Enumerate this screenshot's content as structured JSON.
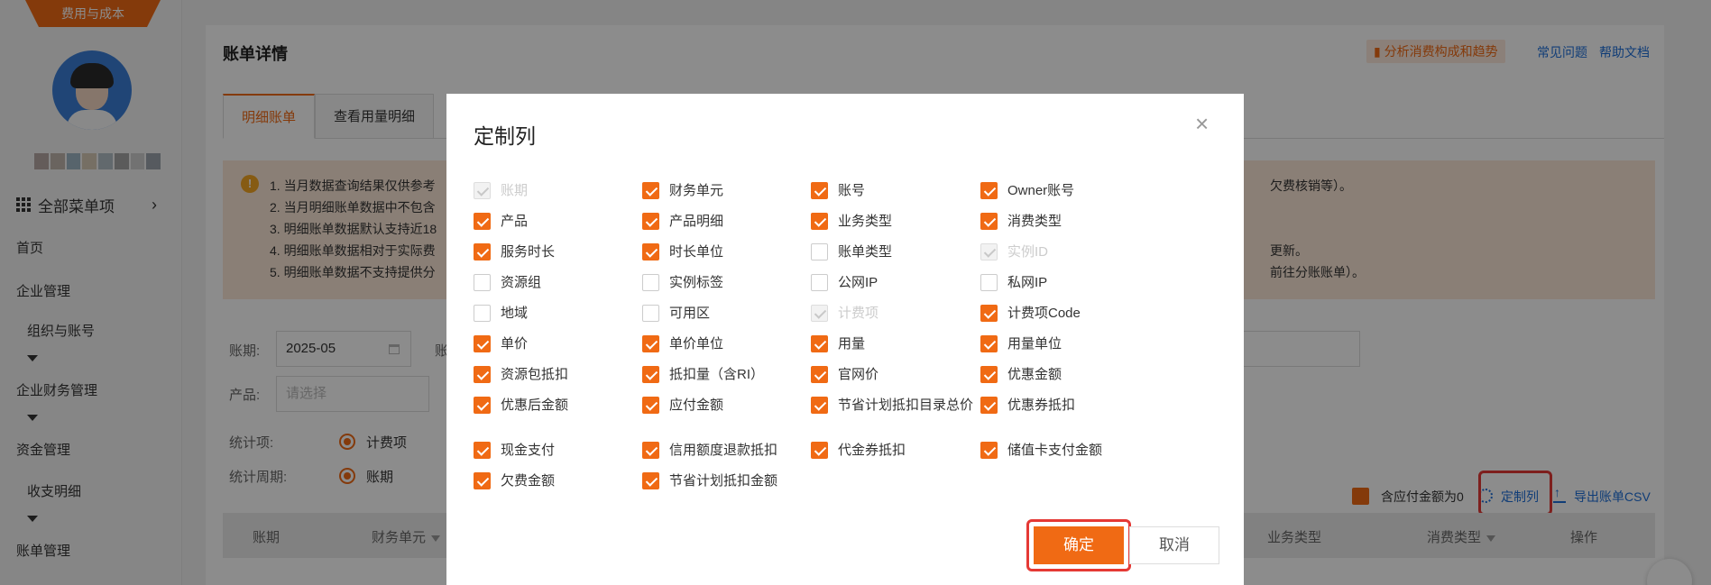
{
  "sidebar": {
    "brand_tab": "费用与成本",
    "name_blur_colors": [
      "#b7a8a5",
      "#c2b6ad",
      "#9fb7c5",
      "#d7cbb7",
      "#b3bfc6",
      "#a7a7a7",
      "#cfcfcf",
      "#9da5ad"
    ],
    "all_menu": "全部菜单项",
    "items": [
      "首页",
      "企业管理",
      "组织与账号",
      "企业财务管理",
      "资金管理",
      "收支明细",
      "账单管理"
    ]
  },
  "main": {
    "title": "账单详情",
    "analysis_button": "分析消费构成和趋势",
    "faq_link": "常见问题",
    "help_link": "帮助文档",
    "tabs": [
      "明细账单",
      "查看用量明细"
    ],
    "notice_lines": [
      "1. 当月数据查询结果仅供参考",
      "2. 当月明细账单数据中不包含",
      "3. 明细账单数据默认支持近18",
      "4. 明细账单数据相对于实际费",
      "5. 明细账单数据不支持提供分"
    ],
    "notice_tails": [
      "欠费核销等）。",
      "更新。",
      "前往分账账单）。"
    ],
    "filters": {
      "period_label": "账期:",
      "period_value": "2025-05",
      "account_label_partial": "账",
      "product_label": "产品:",
      "product_placeholder": "请选择",
      "stat_item_label": "统计项:",
      "stat_item_value": "计费项",
      "stat_period_label": "统计周期:",
      "stat_period_value": "账期"
    },
    "toolbar": {
      "zero_amount_label": "含应付金额为0",
      "customize_columns": "定制列",
      "export_csv": "导出账单CSV"
    },
    "table_headers": [
      "账期",
      "财务单元",
      "业务类型",
      "消费类型",
      "操作"
    ]
  },
  "modal": {
    "title": "定制列",
    "close": "×",
    "confirm": "确定",
    "cancel": "取消",
    "columns": [
      {
        "label": "账期",
        "state": "disabled"
      },
      {
        "label": "财务单元",
        "state": "on"
      },
      {
        "label": "账号",
        "state": "on"
      },
      {
        "label": "Owner账号",
        "state": "on"
      },
      {
        "label": "产品",
        "state": "on"
      },
      {
        "label": "产品明细",
        "state": "on"
      },
      {
        "label": "业务类型",
        "state": "on"
      },
      {
        "label": "消费类型",
        "state": "on"
      },
      {
        "label": "服务时长",
        "state": "on"
      },
      {
        "label": "时长单位",
        "state": "on"
      },
      {
        "label": "账单类型",
        "state": "off"
      },
      {
        "label": "实例ID",
        "state": "disabled"
      },
      {
        "label": "资源组",
        "state": "off"
      },
      {
        "label": "实例标签",
        "state": "off"
      },
      {
        "label": "公网IP",
        "state": "off"
      },
      {
        "label": "私网IP",
        "state": "off"
      },
      {
        "label": "地域",
        "state": "off"
      },
      {
        "label": "可用区",
        "state": "off"
      },
      {
        "label": "计费项",
        "state": "disabled"
      },
      {
        "label": "计费项Code",
        "state": "on"
      },
      {
        "label": "单价",
        "state": "on"
      },
      {
        "label": "单价单位",
        "state": "on"
      },
      {
        "label": "用量",
        "state": "on"
      },
      {
        "label": "用量单位",
        "state": "on"
      },
      {
        "label": "资源包抵扣",
        "state": "on"
      },
      {
        "label": "抵扣量（含RI）",
        "state": "on"
      },
      {
        "label": "官网价",
        "state": "on"
      },
      {
        "label": "优惠金额",
        "state": "on"
      },
      {
        "label": "优惠后金额",
        "state": "on"
      },
      {
        "label": "应付金额",
        "state": "on"
      },
      {
        "label": "节省计划抵扣目录总价",
        "state": "on"
      },
      {
        "label": "优惠券抵扣",
        "state": "on"
      },
      {
        "label": "现金支付",
        "state": "on"
      },
      {
        "label": "信用额度退款抵扣",
        "state": "on"
      },
      {
        "label": "代金券抵扣",
        "state": "on"
      },
      {
        "label": "储值卡支付金额",
        "state": "on"
      },
      {
        "label": "欠费金额",
        "state": "on"
      },
      {
        "label": "节省计划抵扣金额",
        "state": "on"
      }
    ]
  },
  "colors": {
    "accent": "#f06a14",
    "link": "#1e6fd9",
    "highlight": "#e53935",
    "notice_bg": "#fce8d8"
  }
}
